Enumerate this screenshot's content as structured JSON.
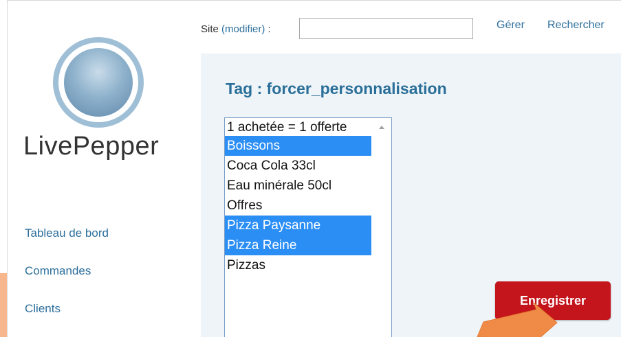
{
  "logo": {
    "text": "LivePepper"
  },
  "sidebar": {
    "items": [
      {
        "label": "Tableau de bord"
      },
      {
        "label": "Commandes"
      },
      {
        "label": "Clients"
      }
    ]
  },
  "topbar": {
    "site_label": "Site",
    "site_modify_link": "(modifier)",
    "site_colon": " :",
    "site_input_value": "",
    "links": [
      {
        "label": "Gérer"
      },
      {
        "label": "Rechercher"
      }
    ]
  },
  "main": {
    "title": "Tag : forcer_personnalisation",
    "listbox": {
      "options": [
        {
          "label": "1 achetée = 1 offerte",
          "selected": false
        },
        {
          "label": "Boissons",
          "selected": true
        },
        {
          "label": "Coca Cola 33cl",
          "selected": false
        },
        {
          "label": "Eau minérale 50cl",
          "selected": false
        },
        {
          "label": "Offres",
          "selected": false
        },
        {
          "label": "Pizza Paysanne",
          "selected": true
        },
        {
          "label": "Pizza Reine",
          "selected": true
        },
        {
          "label": "Pizzas",
          "selected": false
        }
      ]
    },
    "save_button_label": "Enregistrer"
  },
  "colors": {
    "link": "#2d6f9c",
    "title": "#2a6f99",
    "panel_background": "#eef4f8",
    "selection": "#2b8ef5",
    "save_button": "#c4141c",
    "annotation_arrow": "#f08a47"
  },
  "icons": {
    "listbox_scroll": "scroll-up-arrow-icon",
    "annotation": "annotation-arrow-icon"
  }
}
